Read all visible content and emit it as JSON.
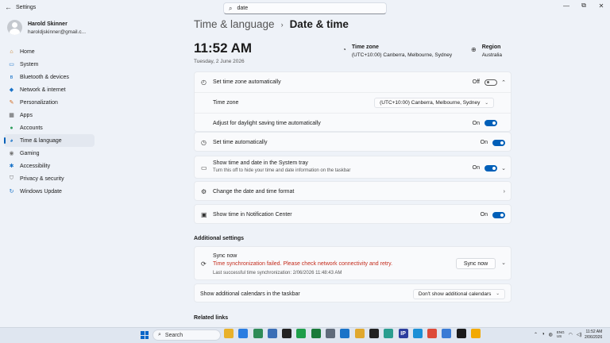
{
  "window": {
    "title": "Settings",
    "search_value": "date"
  },
  "profile": {
    "name": "Harold Skinner",
    "email": "haroldjskinner@gmail.c..."
  },
  "nav": [
    {
      "label": "Home",
      "icon": "home-icon",
      "glyph": "⌂",
      "color": "#c47a1e",
      "active": false
    },
    {
      "label": "System",
      "icon": "system-icon",
      "glyph": "▭",
      "color": "#1a73c8",
      "active": false
    },
    {
      "label": "Bluetooth & devices",
      "icon": "bluetooth-icon",
      "glyph": "ʙ",
      "color": "#1a73c8",
      "active": false
    },
    {
      "label": "Network & internet",
      "icon": "wifi-icon",
      "glyph": "◆",
      "color": "#1a73c8",
      "active": false
    },
    {
      "label": "Personalization",
      "icon": "brush-icon",
      "glyph": "✎",
      "color": "#d2691e",
      "active": false
    },
    {
      "label": "Apps",
      "icon": "apps-icon",
      "glyph": "▦",
      "color": "#555555",
      "active": false
    },
    {
      "label": "Accounts",
      "icon": "accounts-icon",
      "glyph": "●",
      "color": "#2e9d5b",
      "active": false
    },
    {
      "label": "Time & language",
      "icon": "globe-clock-icon",
      "glyph": "◕",
      "color": "#1a73c8",
      "active": true
    },
    {
      "label": "Gaming",
      "icon": "gaming-icon",
      "glyph": "◉",
      "color": "#777777",
      "active": false
    },
    {
      "label": "Accessibility",
      "icon": "accessibility-icon",
      "glyph": "✱",
      "color": "#1a73c8",
      "active": false
    },
    {
      "label": "Privacy & security",
      "icon": "shield-icon",
      "glyph": "⛉",
      "color": "#777777",
      "active": false
    },
    {
      "label": "Windows Update",
      "icon": "update-icon",
      "glyph": "↻",
      "color": "#1a73c8",
      "active": false
    }
  ],
  "header": {
    "parent": "Time & language",
    "separator": "›",
    "current": "Date & time"
  },
  "summary": {
    "time": "11:52 AM",
    "date": "Tuesday, 2 June 2026",
    "timezone_label": "Time zone",
    "timezone_value": "(UTC+10:00) Canberra, Melbourne, Sydney",
    "region_label": "Region",
    "region_value": "Australia"
  },
  "settings": {
    "tz_auto": {
      "label": "Set time zone automatically",
      "state": "Off"
    },
    "tz": {
      "label": "Time zone",
      "value": "(UTC+10:00) Canberra, Melbourne, Sydney"
    },
    "dst": {
      "label": "Adjust for daylight saving time automatically",
      "state": "On"
    },
    "time_auto": {
      "label": "Set time automatically",
      "state": "On"
    },
    "tray": {
      "label": "Show time and date in the System tray",
      "sub": "Turn this off to hide your time and date information on the taskbar",
      "state": "On"
    },
    "format": {
      "label": "Change the date and time format"
    },
    "notif": {
      "label": "Show time in Notification Center",
      "state": "On"
    }
  },
  "additional": {
    "heading": "Additional settings",
    "sync_title": "Sync now",
    "sync_error": "Time synchronization failed. Please check network connectivity and retry.",
    "sync_last": "Last successful time synchronization: 2/06/2026 11:48:43 AM",
    "sync_button": "Sync now",
    "calendars_label": "Show additional calendars in the taskbar",
    "calendars_value": "Don't show additional calendars"
  },
  "related": {
    "heading": "Related links"
  },
  "taskbar": {
    "search_label": "Search",
    "apps": [
      {
        "name": "file-explorer-icon",
        "color": "#e8b12a",
        "glyph": ""
      },
      {
        "name": "app-icon-2",
        "color": "#2a7de1",
        "glyph": ""
      },
      {
        "name": "app-icon-3",
        "color": "#2e8b57",
        "glyph": ""
      },
      {
        "name": "app-icon-4",
        "color": "#3b6fb6",
        "glyph": ""
      },
      {
        "name": "app-icon-5",
        "color": "#222222",
        "glyph": ""
      },
      {
        "name": "app-icon-6",
        "color": "#1e9e4a",
        "glyph": ""
      },
      {
        "name": "app-icon-7",
        "color": "#1a7a3a",
        "glyph": ""
      },
      {
        "name": "settings-app-icon",
        "color": "#5f6b7a",
        "glyph": ""
      },
      {
        "name": "app-icon-9",
        "color": "#1a73c8",
        "glyph": ""
      },
      {
        "name": "app-icon-10",
        "color": "#e0a82e",
        "glyph": ""
      },
      {
        "name": "app-icon-11",
        "color": "#222222",
        "glyph": ""
      },
      {
        "name": "app-icon-12",
        "color": "#2a9d8f",
        "glyph": ""
      },
      {
        "name": "ip-app-icon",
        "color": "#2c3e9e",
        "glyph": "IP"
      },
      {
        "name": "edge-icon",
        "color": "#1b8fd6",
        "glyph": ""
      },
      {
        "name": "chrome-icon",
        "color": "#dd4b39",
        "glyph": ""
      },
      {
        "name": "app-icon-16",
        "color": "#3a7bd5",
        "glyph": ""
      },
      {
        "name": "terminal-icon",
        "color": "#1a1a1a",
        "glyph": ""
      },
      {
        "name": "app-icon-18",
        "color": "#f2a900",
        "glyph": ""
      }
    ],
    "lang": "ENG\nUS",
    "clock_time": "11:52 AM",
    "clock_date": "2/06/2026"
  }
}
